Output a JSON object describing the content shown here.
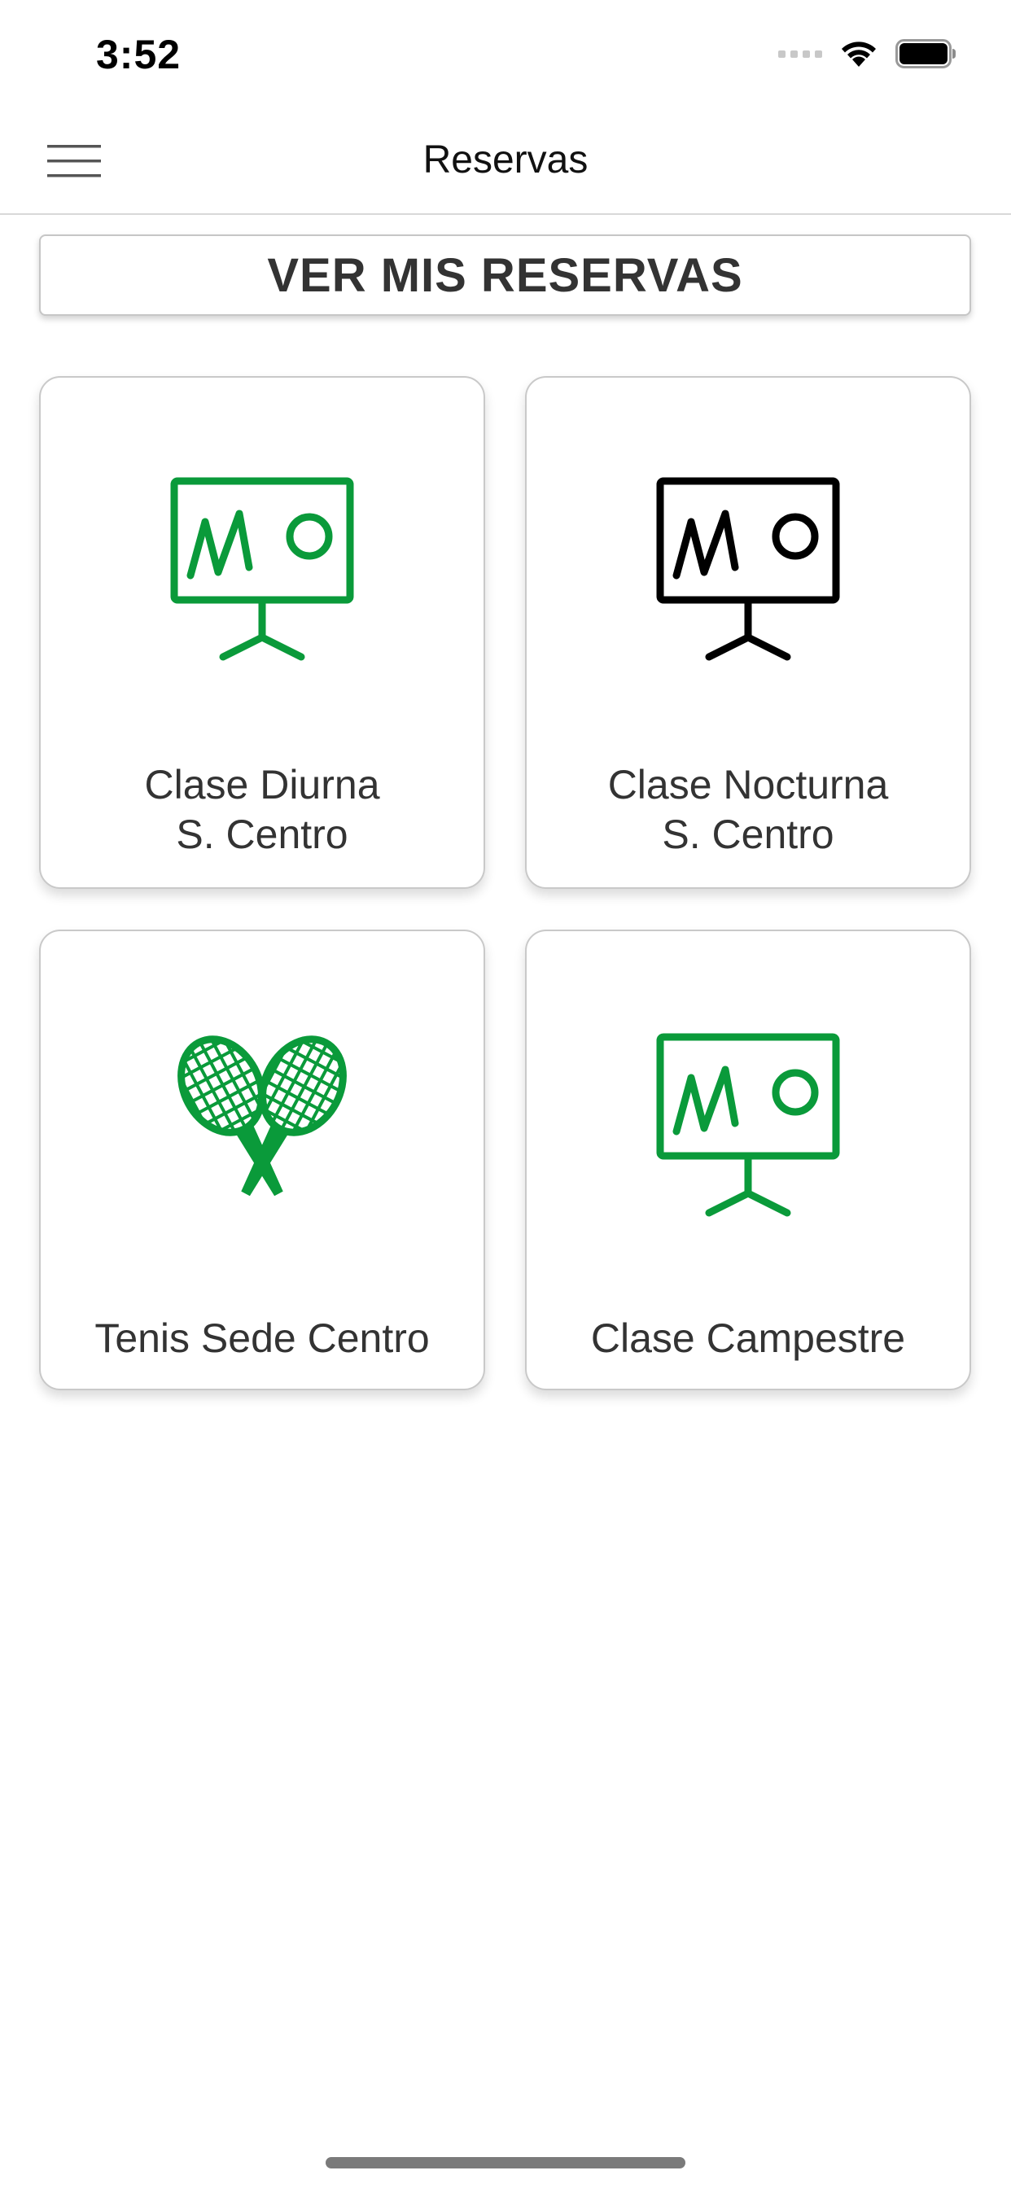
{
  "status_bar": {
    "time": "3:52"
  },
  "header": {
    "title": "Reservas",
    "menu_icon": "hamburger-menu-icon"
  },
  "main": {
    "view_reservations_label": "VER MIS RESERVAS",
    "cards": [
      {
        "line1": "Clase Diurna",
        "line2": "S. Centro",
        "icon": "presentation-board-icon",
        "icon_color": "#0a9a3a"
      },
      {
        "line1": "Clase Nocturna",
        "line2": "S. Centro",
        "icon": "presentation-board-icon",
        "icon_color": "#000000"
      },
      {
        "line1": "Tenis Sede Centro",
        "line2": "",
        "icon": "tennis-rackets-icon",
        "icon_color": "#0a9a3a"
      },
      {
        "line1": "Clase Campestre",
        "line2": "",
        "icon": "presentation-board-icon",
        "icon_color": "#0a9a3a"
      }
    ]
  },
  "colors": {
    "accent_green": "#0a9a3a",
    "text": "#333333",
    "border": "#c9c9c9"
  }
}
